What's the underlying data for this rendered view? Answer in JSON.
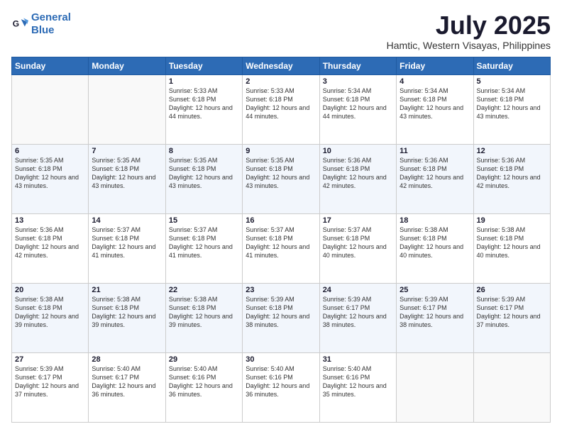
{
  "logo": {
    "line1": "General",
    "line2": "Blue"
  },
  "title": "July 2025",
  "subtitle": "Hamtic, Western Visayas, Philippines",
  "days_of_week": [
    "Sunday",
    "Monday",
    "Tuesday",
    "Wednesday",
    "Thursday",
    "Friday",
    "Saturday"
  ],
  "weeks": [
    [
      {
        "day": "",
        "sunrise": "",
        "sunset": "",
        "daylight": ""
      },
      {
        "day": "",
        "sunrise": "",
        "sunset": "",
        "daylight": ""
      },
      {
        "day": "1",
        "sunrise": "Sunrise: 5:33 AM",
        "sunset": "Sunset: 6:18 PM",
        "daylight": "Daylight: 12 hours and 44 minutes."
      },
      {
        "day": "2",
        "sunrise": "Sunrise: 5:33 AM",
        "sunset": "Sunset: 6:18 PM",
        "daylight": "Daylight: 12 hours and 44 minutes."
      },
      {
        "day": "3",
        "sunrise": "Sunrise: 5:34 AM",
        "sunset": "Sunset: 6:18 PM",
        "daylight": "Daylight: 12 hours and 44 minutes."
      },
      {
        "day": "4",
        "sunrise": "Sunrise: 5:34 AM",
        "sunset": "Sunset: 6:18 PM",
        "daylight": "Daylight: 12 hours and 43 minutes."
      },
      {
        "day": "5",
        "sunrise": "Sunrise: 5:34 AM",
        "sunset": "Sunset: 6:18 PM",
        "daylight": "Daylight: 12 hours and 43 minutes."
      }
    ],
    [
      {
        "day": "6",
        "sunrise": "Sunrise: 5:35 AM",
        "sunset": "Sunset: 6:18 PM",
        "daylight": "Daylight: 12 hours and 43 minutes."
      },
      {
        "day": "7",
        "sunrise": "Sunrise: 5:35 AM",
        "sunset": "Sunset: 6:18 PM",
        "daylight": "Daylight: 12 hours and 43 minutes."
      },
      {
        "day": "8",
        "sunrise": "Sunrise: 5:35 AM",
        "sunset": "Sunset: 6:18 PM",
        "daylight": "Daylight: 12 hours and 43 minutes."
      },
      {
        "day": "9",
        "sunrise": "Sunrise: 5:35 AM",
        "sunset": "Sunset: 6:18 PM",
        "daylight": "Daylight: 12 hours and 43 minutes."
      },
      {
        "day": "10",
        "sunrise": "Sunrise: 5:36 AM",
        "sunset": "Sunset: 6:18 PM",
        "daylight": "Daylight: 12 hours and 42 minutes."
      },
      {
        "day": "11",
        "sunrise": "Sunrise: 5:36 AM",
        "sunset": "Sunset: 6:18 PM",
        "daylight": "Daylight: 12 hours and 42 minutes."
      },
      {
        "day": "12",
        "sunrise": "Sunrise: 5:36 AM",
        "sunset": "Sunset: 6:18 PM",
        "daylight": "Daylight: 12 hours and 42 minutes."
      }
    ],
    [
      {
        "day": "13",
        "sunrise": "Sunrise: 5:36 AM",
        "sunset": "Sunset: 6:18 PM",
        "daylight": "Daylight: 12 hours and 42 minutes."
      },
      {
        "day": "14",
        "sunrise": "Sunrise: 5:37 AM",
        "sunset": "Sunset: 6:18 PM",
        "daylight": "Daylight: 12 hours and 41 minutes."
      },
      {
        "day": "15",
        "sunrise": "Sunrise: 5:37 AM",
        "sunset": "Sunset: 6:18 PM",
        "daylight": "Daylight: 12 hours and 41 minutes."
      },
      {
        "day": "16",
        "sunrise": "Sunrise: 5:37 AM",
        "sunset": "Sunset: 6:18 PM",
        "daylight": "Daylight: 12 hours and 41 minutes."
      },
      {
        "day": "17",
        "sunrise": "Sunrise: 5:37 AM",
        "sunset": "Sunset: 6:18 PM",
        "daylight": "Daylight: 12 hours and 40 minutes."
      },
      {
        "day": "18",
        "sunrise": "Sunrise: 5:38 AM",
        "sunset": "Sunset: 6:18 PM",
        "daylight": "Daylight: 12 hours and 40 minutes."
      },
      {
        "day": "19",
        "sunrise": "Sunrise: 5:38 AM",
        "sunset": "Sunset: 6:18 PM",
        "daylight": "Daylight: 12 hours and 40 minutes."
      }
    ],
    [
      {
        "day": "20",
        "sunrise": "Sunrise: 5:38 AM",
        "sunset": "Sunset: 6:18 PM",
        "daylight": "Daylight: 12 hours and 39 minutes."
      },
      {
        "day": "21",
        "sunrise": "Sunrise: 5:38 AM",
        "sunset": "Sunset: 6:18 PM",
        "daylight": "Daylight: 12 hours and 39 minutes."
      },
      {
        "day": "22",
        "sunrise": "Sunrise: 5:38 AM",
        "sunset": "Sunset: 6:18 PM",
        "daylight": "Daylight: 12 hours and 39 minutes."
      },
      {
        "day": "23",
        "sunrise": "Sunrise: 5:39 AM",
        "sunset": "Sunset: 6:18 PM",
        "daylight": "Daylight: 12 hours and 38 minutes."
      },
      {
        "day": "24",
        "sunrise": "Sunrise: 5:39 AM",
        "sunset": "Sunset: 6:17 PM",
        "daylight": "Daylight: 12 hours and 38 minutes."
      },
      {
        "day": "25",
        "sunrise": "Sunrise: 5:39 AM",
        "sunset": "Sunset: 6:17 PM",
        "daylight": "Daylight: 12 hours and 38 minutes."
      },
      {
        "day": "26",
        "sunrise": "Sunrise: 5:39 AM",
        "sunset": "Sunset: 6:17 PM",
        "daylight": "Daylight: 12 hours and 37 minutes."
      }
    ],
    [
      {
        "day": "27",
        "sunrise": "Sunrise: 5:39 AM",
        "sunset": "Sunset: 6:17 PM",
        "daylight": "Daylight: 12 hours and 37 minutes."
      },
      {
        "day": "28",
        "sunrise": "Sunrise: 5:40 AM",
        "sunset": "Sunset: 6:17 PM",
        "daylight": "Daylight: 12 hours and 36 minutes."
      },
      {
        "day": "29",
        "sunrise": "Sunrise: 5:40 AM",
        "sunset": "Sunset: 6:16 PM",
        "daylight": "Daylight: 12 hours and 36 minutes."
      },
      {
        "day": "30",
        "sunrise": "Sunrise: 5:40 AM",
        "sunset": "Sunset: 6:16 PM",
        "daylight": "Daylight: 12 hours and 36 minutes."
      },
      {
        "day": "31",
        "sunrise": "Sunrise: 5:40 AM",
        "sunset": "Sunset: 6:16 PM",
        "daylight": "Daylight: 12 hours and 35 minutes."
      },
      {
        "day": "",
        "sunrise": "",
        "sunset": "",
        "daylight": ""
      },
      {
        "day": "",
        "sunrise": "",
        "sunset": "",
        "daylight": ""
      }
    ]
  ]
}
